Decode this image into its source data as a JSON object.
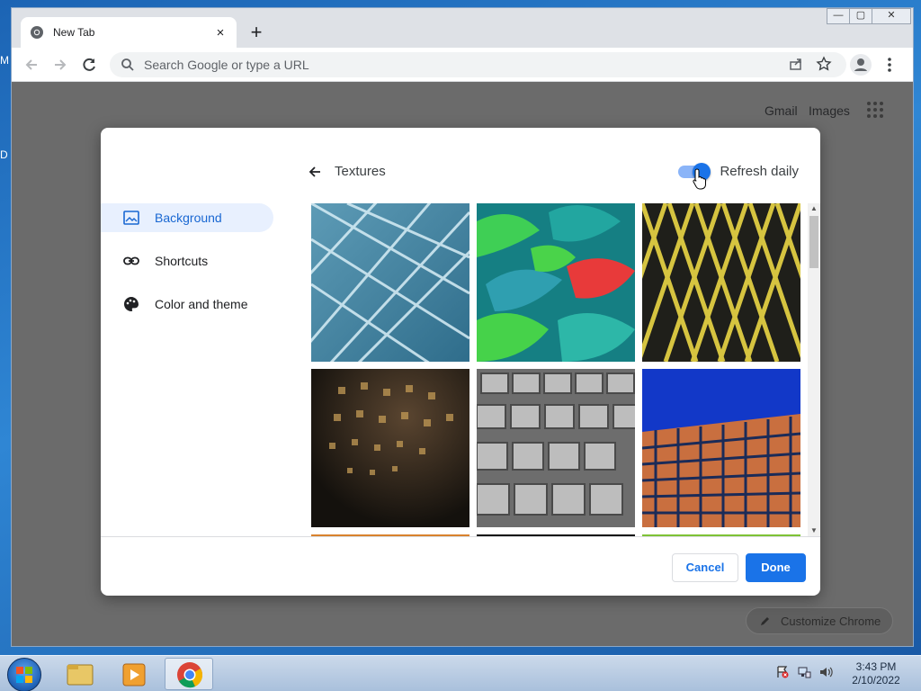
{
  "browser": {
    "tab_title": "New Tab",
    "new_tab_symbol": "+",
    "close_symbol": "×",
    "omnibox_placeholder": "Search Google or type a URL"
  },
  "window_controls": {
    "minimize": "—",
    "restore": "▢",
    "close": "✕"
  },
  "ntp": {
    "gmail": "Gmail",
    "images": "Images",
    "customize_label": "Customize Chrome"
  },
  "dialog": {
    "heading": "Textures",
    "refresh_label": "Refresh daily",
    "refresh_on": true,
    "menu": [
      {
        "label": "Background",
        "icon": "image-icon",
        "active": true
      },
      {
        "label": "Shortcuts",
        "icon": "link-icon",
        "active": false
      },
      {
        "label": "Color and theme",
        "icon": "palette-icon",
        "active": false
      }
    ],
    "tiles": [
      {
        "name": "texture-blue-glass",
        "colors": [
          "#3a7b98",
          "#a8d3e2"
        ]
      },
      {
        "name": "texture-green-shingles",
        "colors": [
          "#1bb38a",
          "#49e04a"
        ]
      },
      {
        "name": "texture-yellow-lattice",
        "colors": [
          "#2a2a20",
          "#d6c440"
        ]
      },
      {
        "name": "texture-gold-mesh",
        "colors": [
          "#201a14",
          "#c29a55"
        ]
      },
      {
        "name": "texture-grey-facade",
        "colors": [
          "#5a5a5a",
          "#c7c7c7"
        ]
      },
      {
        "name": "texture-orange-building",
        "colors": [
          "#1a3ec8",
          "#c86a3c"
        ]
      }
    ],
    "cancel_label": "Cancel",
    "done_label": "Done"
  },
  "desktop": {
    "fragment_1": "M",
    "fragment_2": "D"
  },
  "taskbar": {
    "time": "3:43 PM",
    "date": "2/10/2022",
    "apps": [
      "explorer-icon",
      "media-player-icon",
      "chrome-icon"
    ]
  },
  "colors": {
    "accent": "#1a73e8",
    "active_menu_bg": "#e8f0fe"
  }
}
